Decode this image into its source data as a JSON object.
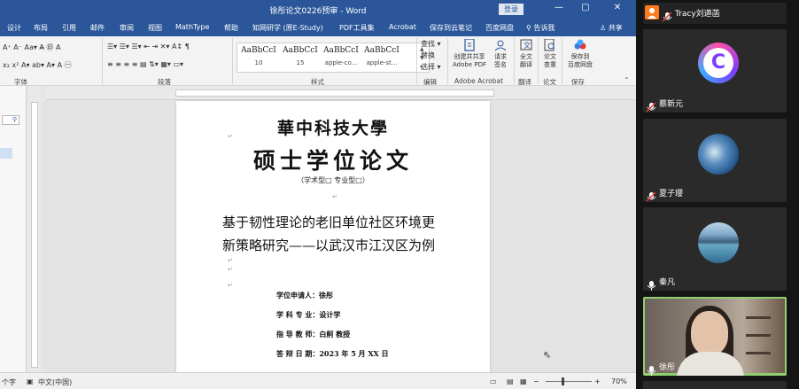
{
  "word": {
    "title": "徐彤论文0226预审 - Word",
    "login_label": "登录",
    "window_controls": {
      "minimize": "—",
      "restore": "▢",
      "close": "✕"
    },
    "tabs": [
      "设计",
      "布局",
      "引用",
      "邮件",
      "审阅",
      "视图",
      "MathType",
      "帮助",
      "知网研学 (原E-Study)",
      "PDF工具集",
      "Acrobat",
      "保存到云笔记",
      "百度网盘"
    ],
    "tell_me": "告诉我",
    "share": "共享",
    "ribbon": {
      "font_row1": "A⁺ A⁻ Aa▾  A̶  ㊞ A",
      "font_row2": "x₂ x²  A▾  ab▾  A▾  A  ㊀",
      "font_group": "字体",
      "para_row1": "☰▾ ☰▾ ☰▾  ⇤ ⇥  ✕▾  A↕  ¶",
      "para_row2": "≡ ≡ ≡ ≡  ▤  ⇅▾  ▦▾  ▭▾",
      "para_group": "段落",
      "styles": [
        {
          "sample": "AaBbCcI",
          "name": "10"
        },
        {
          "sample": "AaBbCcI",
          "name": "15"
        },
        {
          "sample": "AaBbCcI",
          "name": "apple-co..."
        },
        {
          "sample": "AaBbCcI",
          "name": "apple-st..."
        }
      ],
      "styles_group": "样式",
      "find": "查找 ▾",
      "replace": "替换",
      "select": "选择 ▾",
      "edit_group": "编辑",
      "create_pdf": "创建并共享\nAdobe PDF",
      "request_sign": "请求\n签名",
      "adobe_group": "Adobe Acrobat",
      "translate": "全文\n翻译",
      "translate_group": "翻译",
      "paper_check": "论文\n查重",
      "paper_group": "论文",
      "baidu_save": "保存到\n百度网盘",
      "save_group": "保存"
    },
    "document": {
      "university": "華中科技大學",
      "degree_title": "硕士学位论文",
      "degree_type": "（学术型□      专业型□）",
      "thesis_title_line1": "基于韧性理论的老旧单位社区环境更",
      "thesis_title_line2": "新策略研究——以武汉市江汉区为例",
      "info": [
        {
          "label": "学位申请人：",
          "value": "徐彤"
        },
        {
          "label": "学 科 专 业：",
          "value": "设计学"
        },
        {
          "label": "指 导 教 师：",
          "value": "白舸    教授"
        },
        {
          "label": "答 辩 日 期：",
          "value": "2023 年 5 月 XX 日"
        }
      ]
    },
    "status": {
      "word_count": "个字",
      "language": "中文(中国)",
      "zoom": "70%"
    }
  },
  "meeting": {
    "participants": [
      {
        "name": "Tracy刘遒菡",
        "type": "bar"
      },
      {
        "name": "蔡新元",
        "type": "avatar-letter",
        "letter": "C"
      },
      {
        "name": "夏子璎",
        "type": "avatar-photo"
      },
      {
        "name": "秦凡",
        "type": "avatar-photo"
      },
      {
        "name": "徐彤",
        "type": "video"
      }
    ]
  },
  "colors": {
    "word_blue": "#2b579a",
    "panel_bg": "#151515",
    "tile_bg": "#2a2a2a",
    "mic_red": "#e53935"
  }
}
